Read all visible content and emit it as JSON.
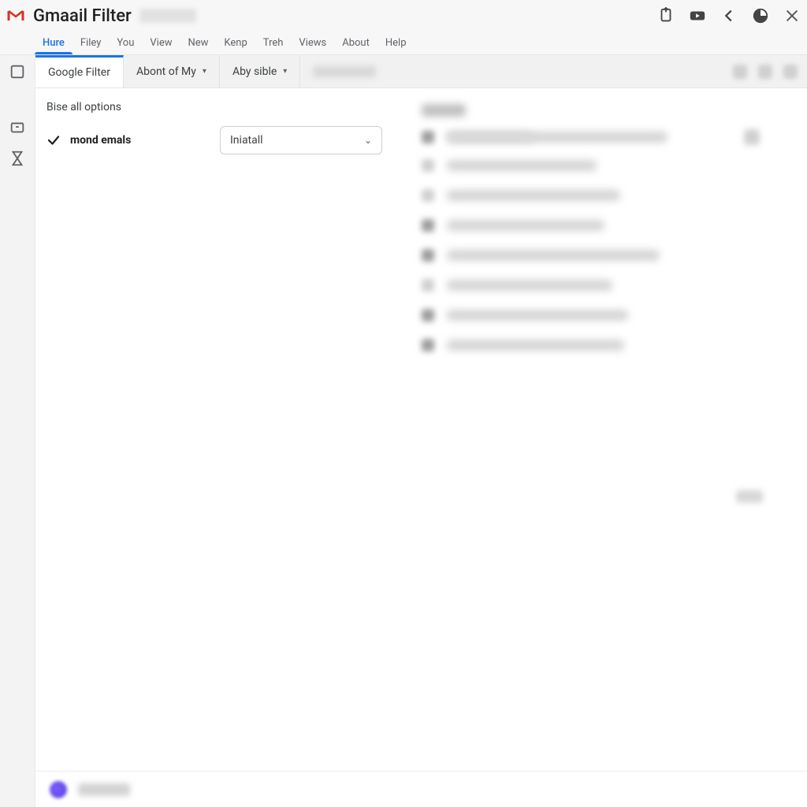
{
  "app": {
    "title": "Gmaail Filter"
  },
  "menus": [
    {
      "label": "Hure",
      "active": true
    },
    {
      "label": "Filey"
    },
    {
      "label": "You"
    },
    {
      "label": "View"
    },
    {
      "label": "New"
    },
    {
      "label": "Kenp"
    },
    {
      "label": "Treh"
    },
    {
      "label": "Views"
    },
    {
      "label": "About"
    },
    {
      "label": "Help"
    }
  ],
  "tabs": [
    {
      "label": "Google Filter",
      "active": true,
      "kind": "plain"
    },
    {
      "label": "Abont of My",
      "kind": "dropdown"
    },
    {
      "label": "Aby sible",
      "kind": "dropdown"
    },
    {
      "label": "",
      "kind": "blur"
    }
  ],
  "panel": {
    "section_title": "Bise all options",
    "option_label": "mond emals",
    "select_value": "Iniatall"
  },
  "colors": {
    "accent": "#1a73e8",
    "text": "#202124",
    "muted": "#5f6368"
  }
}
